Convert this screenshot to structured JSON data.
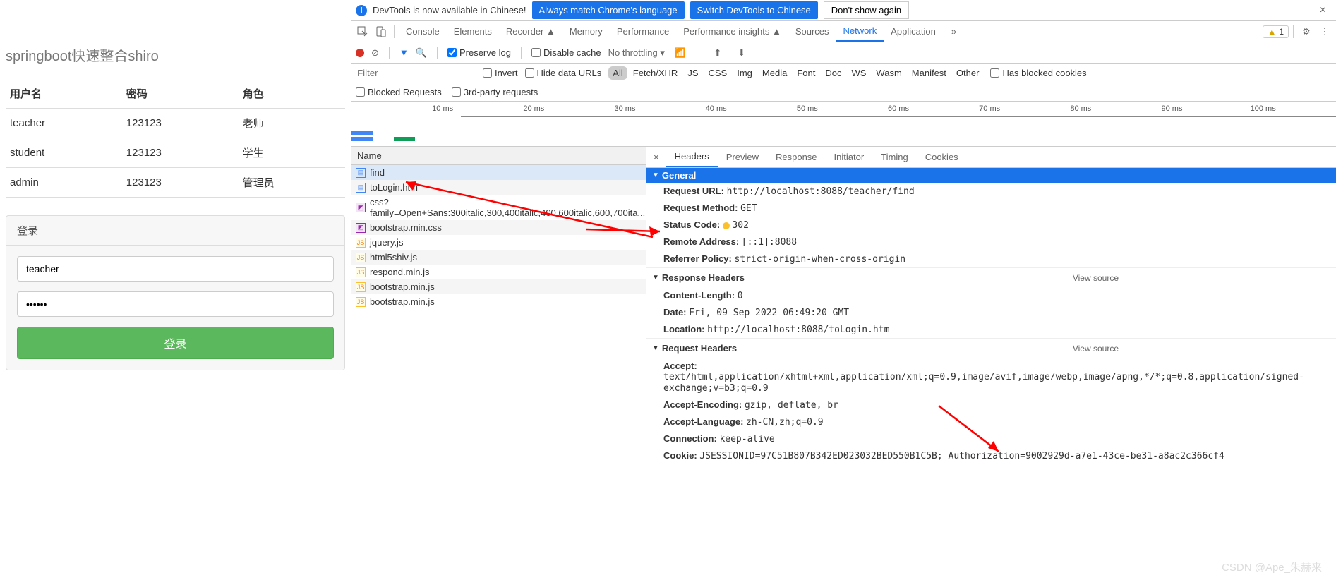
{
  "page": {
    "title": "springboot快速整合shiro",
    "table": {
      "headers": [
        "用户名",
        "密码",
        "角色"
      ],
      "rows": [
        {
          "user": "teacher",
          "pass": "123123",
          "role": "老师"
        },
        {
          "user": "student",
          "pass": "123123",
          "role": "学生"
        },
        {
          "user": "admin",
          "pass": "123123",
          "role": "管理员"
        }
      ]
    },
    "login": {
      "panel_title": "登录",
      "username_value": "teacher",
      "password_value": "••••••",
      "submit_label": "登录"
    }
  },
  "devtools": {
    "lang_bar": {
      "msg": "DevTools is now available in Chinese!",
      "btn1": "Always match Chrome's language",
      "btn2": "Switch DevTools to Chinese",
      "btn3": "Don't show again"
    },
    "tabs": [
      "Console",
      "Elements",
      "Recorder ▲",
      "Memory",
      "Performance",
      "Performance insights ▲",
      "Sources",
      "Network",
      "Application"
    ],
    "active_tab": "Network",
    "issues_count": "1",
    "filter_bar": {
      "preserve_log": "Preserve log",
      "disable_cache": "Disable cache",
      "throttling": "No throttling"
    },
    "filter_row2": {
      "placeholder": "Filter",
      "invert": "Invert",
      "hide_data": "Hide data URLs",
      "types": [
        "All",
        "Fetch/XHR",
        "JS",
        "CSS",
        "Img",
        "Media",
        "Font",
        "Doc",
        "WS",
        "Wasm",
        "Manifest",
        "Other"
      ],
      "active_type": "All",
      "blocked_cookies": "Has blocked cookies"
    },
    "filter_row3": {
      "blocked_req": "Blocked Requests",
      "third_party": "3rd-party requests"
    },
    "timeline_ticks": [
      "10 ms",
      "20 ms",
      "30 ms",
      "40 ms",
      "50 ms",
      "60 ms",
      "70 ms",
      "80 ms",
      "90 ms",
      "100 ms"
    ],
    "requests": {
      "header": "Name",
      "items": [
        {
          "name": "find",
          "type": "doc",
          "selected": true
        },
        {
          "name": "toLogin.htm",
          "type": "doc"
        },
        {
          "name": "css?family=Open+Sans:300italic,300,400italic,400,600italic,600,700ita...",
          "type": "css"
        },
        {
          "name": "bootstrap.min.css",
          "type": "css"
        },
        {
          "name": "jquery.js",
          "type": "js"
        },
        {
          "name": "html5shiv.js",
          "type": "js"
        },
        {
          "name": "respond.min.js",
          "type": "js"
        },
        {
          "name": "bootstrap.min.js",
          "type": "js"
        },
        {
          "name": "bootstrap.min.js",
          "type": "js"
        }
      ]
    },
    "detail_tabs": [
      "Headers",
      "Preview",
      "Response",
      "Initiator",
      "Timing",
      "Cookies"
    ],
    "active_detail_tab": "Headers",
    "general": {
      "title": "General",
      "request_url_label": "Request URL:",
      "request_url": "http://localhost:8088/teacher/find",
      "method_label": "Request Method:",
      "method": "GET",
      "status_label": "Status Code:",
      "status": "302",
      "remote_label": "Remote Address:",
      "remote": "[::1]:8088",
      "referrer_label": "Referrer Policy:",
      "referrer": "strict-origin-when-cross-origin"
    },
    "response_headers": {
      "title": "Response Headers",
      "view_source": "View source",
      "items": [
        {
          "k": "Content-Length:",
          "v": "0"
        },
        {
          "k": "Date:",
          "v": "Fri, 09 Sep 2022 06:49:20 GMT"
        },
        {
          "k": "Location:",
          "v": "http://localhost:8088/toLogin.htm"
        }
      ]
    },
    "request_headers": {
      "title": "Request Headers",
      "view_source": "View source",
      "items": [
        {
          "k": "Accept:",
          "v": "text/html,application/xhtml+xml,application/xml;q=0.9,image/avif,image/webp,image/apng,*/*;q=0.8,application/signed-exchange;v=b3;q=0.9"
        },
        {
          "k": "Accept-Encoding:",
          "v": "gzip, deflate, br"
        },
        {
          "k": "Accept-Language:",
          "v": "zh-CN,zh;q=0.9"
        },
        {
          "k": "Connection:",
          "v": "keep-alive"
        },
        {
          "k": "Cookie:",
          "v": "JSESSIONID=97C51B807B342ED023032BED550B1C5B; Authorization=9002929d-a7e1-43ce-be31-a8ac2c366cf4"
        }
      ]
    }
  },
  "watermark": "CSDN @Ape_朱赫来"
}
